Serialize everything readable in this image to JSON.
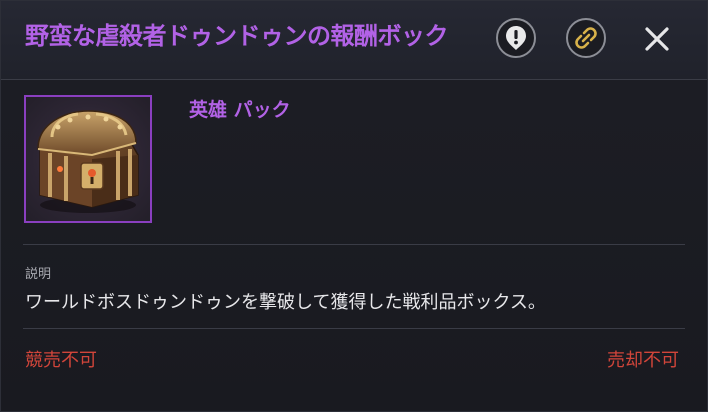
{
  "header": {
    "title": "野蛮な虐殺者ドゥンドゥンの報酬ボック",
    "buttons": [
      {
        "icon": "warning-pin-icon"
      },
      {
        "icon": "link-icon"
      },
      {
        "icon": "close-icon"
      }
    ]
  },
  "item": {
    "icon": "treasure-chest-icon",
    "grade": "英雄  パック",
    "grade_color": "#b262e6",
    "frame_color": "#8a3fc0"
  },
  "description": {
    "label": "説明",
    "text": "ワールドボスドゥンドゥンを撃破して獲得した戦利品ボックス。"
  },
  "restrictions": {
    "auction": "競売不可",
    "sell": "売却不可",
    "color": "#d2453a"
  }
}
